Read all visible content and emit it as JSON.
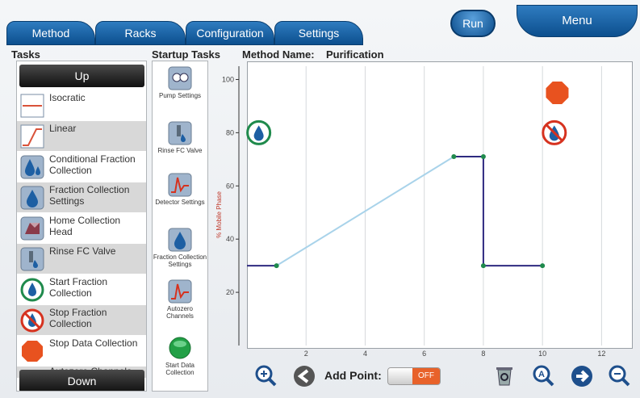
{
  "tabs": [
    {
      "label": "Method"
    },
    {
      "label": "Racks"
    },
    {
      "label": "Configuration"
    },
    {
      "label": "Settings"
    }
  ],
  "run_label": "Run",
  "menu_label": "Menu",
  "tasks_header": "Tasks",
  "startup_header": "Startup Tasks",
  "method_name_label": "Method Name:",
  "method_name_value": "Purification",
  "tasks": {
    "up_label": "Up",
    "down_label": "Down",
    "items": [
      {
        "label": "Isocratic",
        "icon": "isocratic-icon"
      },
      {
        "label": "Linear",
        "icon": "linear-icon"
      },
      {
        "label": "Conditional Fraction Collection",
        "icon": "conditional-fraction-icon"
      },
      {
        "label": "Fraction Collection Settings",
        "icon": "droplet-icon"
      },
      {
        "label": "Home Collection Head",
        "icon": "home-head-icon"
      },
      {
        "label": "Rinse FC Valve",
        "icon": "valve-icon"
      },
      {
        "label": "Start Fraction Collection",
        "icon": "start-fraction-icon"
      },
      {
        "label": "Stop Fraction Collection",
        "icon": "stop-fraction-icon"
      },
      {
        "label": "Stop Data Collection",
        "icon": "stop-octagon-icon"
      },
      {
        "label": "Autozero Channels",
        "icon": "autozero-icon"
      }
    ]
  },
  "startup_tasks": [
    {
      "label": "Pump Settings",
      "icon": "pump-icon"
    },
    {
      "label": "Rinse FC Valve",
      "icon": "valve-icon"
    },
    {
      "label": "Detector Settings",
      "icon": "detector-icon"
    },
    {
      "label": "Fraction Collection Settings",
      "icon": "droplet-icon"
    },
    {
      "label": "Autozero Channels",
      "icon": "autozero-icon"
    },
    {
      "label": "Start Data Collection",
      "icon": "green-circle-icon"
    }
  ],
  "toolbar": {
    "add_point_label": "Add Point:",
    "toggle_state": "OFF"
  },
  "chart_data": {
    "type": "line",
    "ylabel": "% Mobile Phase",
    "xlim": [
      0,
      13
    ],
    "ylim": [
      0,
      105
    ],
    "yticks": [
      20,
      40,
      60,
      80,
      100
    ],
    "xticks": [
      2,
      4,
      6,
      8,
      10,
      12
    ],
    "segments": [
      {
        "kind": "isocratic",
        "points": [
          [
            0,
            30
          ],
          [
            1,
            30
          ]
        ]
      },
      {
        "kind": "linear",
        "points": [
          [
            1,
            30
          ],
          [
            7,
            71
          ]
        ]
      },
      {
        "kind": "isocratic",
        "points": [
          [
            7,
            71
          ],
          [
            8,
            71
          ]
        ]
      },
      {
        "kind": "step",
        "points": [
          [
            8,
            71
          ],
          [
            8,
            30
          ]
        ]
      },
      {
        "kind": "isocratic",
        "points": [
          [
            8,
            30
          ],
          [
            10,
            30
          ]
        ]
      }
    ],
    "markers": [
      {
        "name": "start-fraction",
        "x": 0.4,
        "y": 80
      },
      {
        "name": "stop-data",
        "x": 10.5,
        "y": 95
      },
      {
        "name": "stop-fraction",
        "x": 10.4,
        "y": 80
      }
    ],
    "grid": true,
    "colors": {
      "isocratic": "#2e2a80",
      "linear": "#a9d3ea",
      "point": "#1f8a4c"
    }
  }
}
